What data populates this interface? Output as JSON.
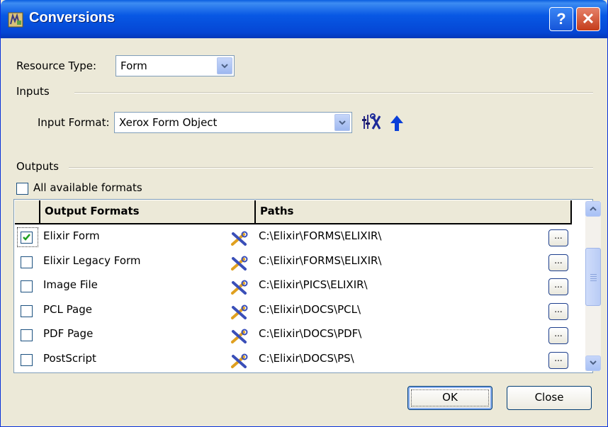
{
  "window": {
    "title": "Conversions"
  },
  "titlebar": {
    "help_glyph": "?",
    "close_glyph": "✕"
  },
  "resource_type": {
    "label": "Resource Type:",
    "value": "Form"
  },
  "inputs": {
    "section_label": "Inputs",
    "format_label": "Input Format:",
    "format_value": "Xerox Form Object",
    "tool_buttons": [
      "settings-tools-icon",
      "arrow-up-icon"
    ]
  },
  "outputs": {
    "section_label": "Outputs",
    "all_formats_label": "All available formats",
    "all_formats_checked": false
  },
  "grid": {
    "columns": [
      "Output Formats",
      "Paths"
    ],
    "browse_label": "...",
    "rows": [
      {
        "name": "Elixir Form",
        "path": "C:\\Elixir\\FORMS\\ELIXIR\\",
        "checked": true
      },
      {
        "name": "Elixir Legacy Form",
        "path": "C:\\Elixir\\FORMS\\ELIXIR\\",
        "checked": false
      },
      {
        "name": "Image File",
        "path": "C:\\Elixir\\PICS\\ELIXIR\\",
        "checked": false
      },
      {
        "name": "PCL Page",
        "path": "C:\\Elixir\\DOCS\\PCL\\",
        "checked": false
      },
      {
        "name": "PDF Page",
        "path": "C:\\Elixir\\DOCS\\PDF\\",
        "checked": false
      },
      {
        "name": "PostScript",
        "path": "C:\\Elixir\\DOCS\\PS\\",
        "checked": false
      }
    ]
  },
  "buttons": {
    "ok": "OK",
    "close": "Close"
  },
  "colors": {
    "titlebar": "#0858e4",
    "face": "#ece9d8",
    "check": "#21a121",
    "accent_arrow": "#0a3fd8"
  }
}
